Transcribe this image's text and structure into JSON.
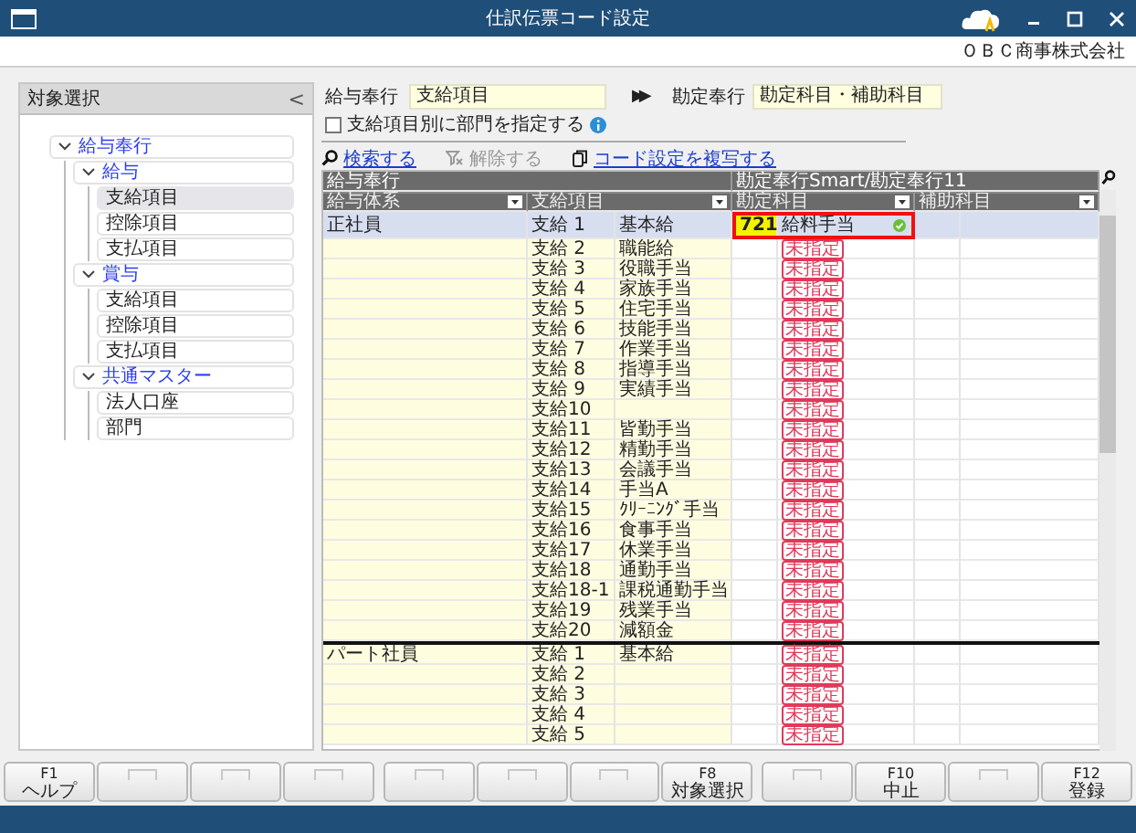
{
  "window": {
    "title": "仕訳伝票コード設定",
    "company": "ＯＢＣ商事株式会社"
  },
  "sidebar": {
    "title": "対象選択",
    "collapse": "<",
    "tree": [
      {
        "label": "給与奉行",
        "expanded": true,
        "selected": false,
        "children": [
          {
            "label": "給与",
            "expanded": true,
            "selected": false,
            "children": [
              {
                "label": "支給項目",
                "selected": true
              },
              {
                "label": "控除項目",
                "selected": false
              },
              {
                "label": "支払項目",
                "selected": false
              }
            ]
          },
          {
            "label": "賞与",
            "expanded": true,
            "selected": false,
            "children": [
              {
                "label": "支給項目",
                "selected": false
              },
              {
                "label": "控除項目",
                "selected": false
              },
              {
                "label": "支払項目",
                "selected": false
              }
            ]
          },
          {
            "label": "共通マスター",
            "expanded": true,
            "selected": false,
            "children": [
              {
                "label": "法人口座",
                "selected": false
              },
              {
                "label": "部門",
                "selected": false
              }
            ]
          }
        ]
      }
    ]
  },
  "mapping": {
    "source_label": "給与奉行",
    "source_value": "支給項目",
    "arrow": "▶▶",
    "target_label": "勘定奉行",
    "target_value": "勘定科目・補助科目"
  },
  "dept_option": {
    "label": "支給項目別に部門を指定する",
    "checked": false
  },
  "actions": [
    {
      "label": "検索する",
      "kind": "search",
      "disabled": false
    },
    {
      "label": "解除する",
      "kind": "clear",
      "disabled": true
    },
    {
      "label": "コード設定を複写する",
      "kind": "copy",
      "disabled": false
    }
  ],
  "table": {
    "group_headers": [
      "給与奉行",
      "勘定奉行Smart/勘定奉行11"
    ],
    "columns": [
      "給与体系",
      "支給項目",
      "勘定科目",
      "補助科目"
    ],
    "groups": [
      {
        "name": "正社員",
        "rows": [
          {
            "code": "支給 1",
            "name": "基本給",
            "account_code": "721",
            "account_name": "給料手当",
            "confirmed": true,
            "selected": true
          },
          {
            "code": "支給 2",
            "name": "職能給",
            "status_label": "未指定",
            "selected": false
          },
          {
            "code": "支給 3",
            "name": "役職手当",
            "status_label": "未指定",
            "selected": false
          },
          {
            "code": "支給 4",
            "name": "家族手当",
            "status_label": "未指定",
            "selected": false
          },
          {
            "code": "支給 5",
            "name": "住宅手当",
            "status_label": "未指定",
            "selected": false
          },
          {
            "code": "支給 6",
            "name": "技能手当",
            "status_label": "未指定",
            "selected": false
          },
          {
            "code": "支給 7",
            "name": "作業手当",
            "status_label": "未指定",
            "selected": false
          },
          {
            "code": "支給 8",
            "name": "指導手当",
            "status_label": "未指定",
            "selected": false
          },
          {
            "code": "支給 9",
            "name": "実績手当",
            "status_label": "未指定",
            "selected": false
          },
          {
            "code": "支給10",
            "status_label": "未指定",
            "selected": false
          },
          {
            "code": "支給11",
            "name": "皆勤手当",
            "status_label": "未指定",
            "selected": false
          },
          {
            "code": "支給12",
            "name": "精勤手当",
            "status_label": "未指定",
            "selected": false
          },
          {
            "code": "支給13",
            "name": "会議手当",
            "status_label": "未指定",
            "selected": false
          },
          {
            "code": "支給14",
            "name": "手当A",
            "status_label": "未指定",
            "selected": false
          },
          {
            "code": "支給15",
            "name": "ｸﾘｰﾆﾝｸﾞ手当",
            "status_label": "未指定",
            "selected": false
          },
          {
            "code": "支給16",
            "name": "食事手当",
            "status_label": "未指定",
            "selected": false
          },
          {
            "code": "支給17",
            "name": "休業手当",
            "status_label": "未指定",
            "selected": false
          },
          {
            "code": "支給18",
            "name": "通勤手当",
            "status_label": "未指定",
            "selected": false
          },
          {
            "code": "支給18-1",
            "name": "課税通勤手当",
            "status_label": "未指定",
            "selected": false
          },
          {
            "code": "支給19",
            "name": "残業手当",
            "status_label": "未指定",
            "selected": false
          },
          {
            "code": "支給20",
            "name": "減額金",
            "status_label": "未指定",
            "selected": false
          }
        ]
      },
      {
        "name": "パート社員",
        "rows": [
          {
            "code": "支給 1",
            "name": "基本給",
            "status_label": "未指定",
            "selected": false
          },
          {
            "code": "支給 2",
            "status_label": "未指定",
            "selected": false
          },
          {
            "code": "支給 3",
            "status_label": "未指定",
            "selected": false
          },
          {
            "code": "支給 4",
            "status_label": "未指定",
            "selected": false
          },
          {
            "code": "支給 5",
            "status_label": "未指定",
            "selected": false
          }
        ]
      }
    ]
  },
  "function_keys": [
    {
      "key": "F1",
      "label": "ヘルプ"
    },
    {
      "kind": "blank"
    },
    {
      "kind": "blank"
    },
    {
      "kind": "blank"
    },
    {
      "kind": "blank"
    },
    {
      "kind": "blank"
    },
    {
      "kind": "blank"
    },
    {
      "key": "F8",
      "label": "対象選択"
    },
    {
      "kind": "blank"
    },
    {
      "key": "F10",
      "label": "中止"
    },
    {
      "kind": "blank"
    },
    {
      "key": "F12",
      "label": "登録"
    }
  ]
}
